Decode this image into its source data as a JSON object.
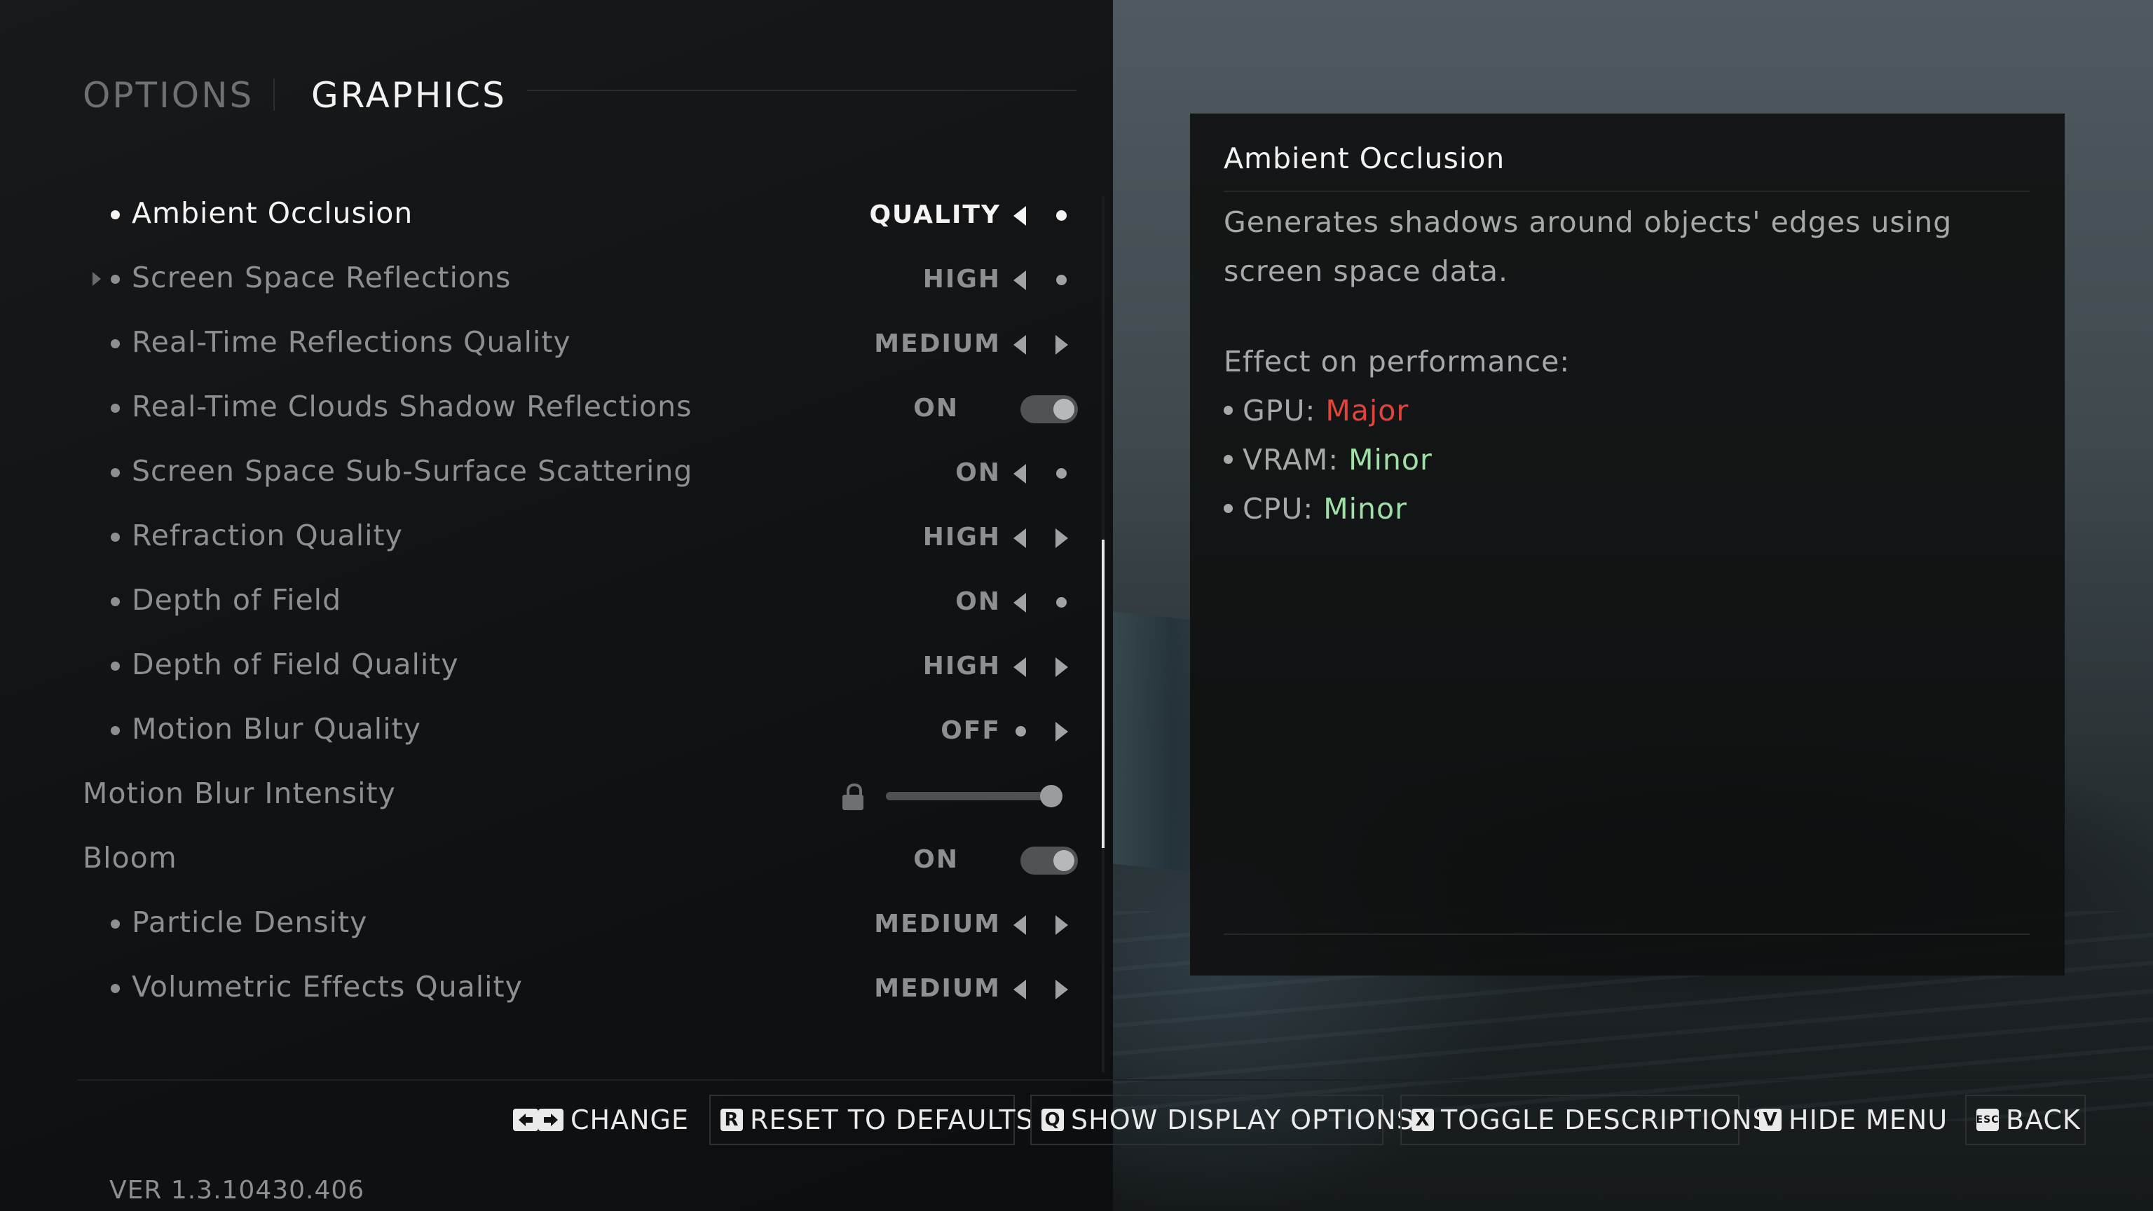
{
  "tabs": {
    "options": "OPTIONS",
    "graphics": "GRAPHICS"
  },
  "settings": [
    {
      "label": "Ambient Occlusion",
      "value": "QUALITY",
      "control": "arrows",
      "active": true
    },
    {
      "label": "Screen Space Reflections",
      "value": "HIGH",
      "control": "arrows"
    },
    {
      "label": "Real-Time Reflections Quality",
      "value": "MEDIUM",
      "control": "arrows"
    },
    {
      "label": "Real-Time Clouds Shadow Reflections",
      "value": "ON",
      "control": "toggle"
    },
    {
      "label": "Screen Space Sub-Surface Scattering",
      "value": "ON",
      "control": "arrows"
    },
    {
      "label": "Refraction Quality",
      "value": "HIGH",
      "control": "arrows"
    },
    {
      "label": "Depth of Field",
      "value": "ON",
      "control": "arrows"
    },
    {
      "label": "Depth of Field Quality",
      "value": "HIGH",
      "control": "arrows"
    },
    {
      "label": "Motion Blur Quality",
      "value": "OFF",
      "control": "arrows"
    },
    {
      "label": "Motion Blur Intensity",
      "value": "",
      "control": "slider",
      "level": 1.0,
      "locked": true
    },
    {
      "label": "Bloom",
      "value": "ON",
      "control": "toggle"
    },
    {
      "label": "Particle Density",
      "value": "MEDIUM",
      "control": "arrows"
    },
    {
      "label": "Volumetric Effects Quality",
      "value": "MEDIUM",
      "control": "arrows"
    }
  ],
  "description": {
    "title": "Ambient Occlusion",
    "body": "Generates shadows around objects' edges using screen space data.",
    "performance_heading": "Effect on performance:",
    "performance": [
      {
        "label": "GPU:",
        "value": "Major",
        "color": "#e0443a"
      },
      {
        "label": "VRAM:",
        "value": "Minor",
        "color": "#9ee0a6"
      },
      {
        "label": "CPU:",
        "value": "Minor",
        "color": "#9ee0a6"
      }
    ]
  },
  "hints": {
    "change": "CHANGE",
    "reset_key": "R",
    "reset": "RESET TO DEFAULTS",
    "display_key": "Q",
    "display": "SHOW DISPLAY OPTIONS",
    "toggle_key": "X",
    "toggle": "TOGGLE DESCRIPTIONS",
    "hide_key": "V",
    "hide": "HIDE MENU",
    "back_key": "ESC",
    "back": "BACK"
  },
  "version": "VER 1.3.10430.406"
}
